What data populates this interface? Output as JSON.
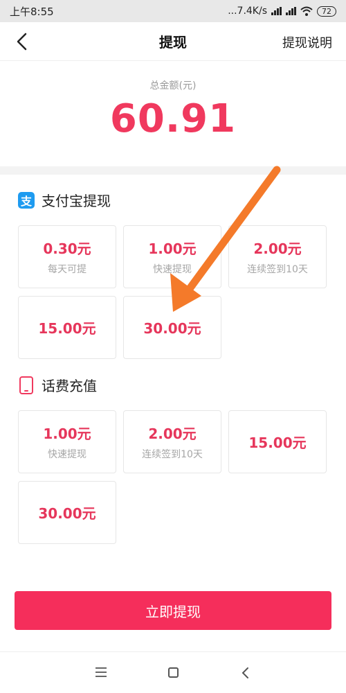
{
  "status": {
    "time": "上午8:55",
    "network_speed": "...7.4K/s",
    "battery": "72"
  },
  "nav": {
    "title": "提现",
    "help_label": "提现说明"
  },
  "total": {
    "label": "总金额(元)",
    "amount": "60.91"
  },
  "alipay": {
    "title": "支付宝提现",
    "icon_glyph": "支",
    "options": [
      {
        "amount": "0.30元",
        "desc": "每天可提"
      },
      {
        "amount": "1.00元",
        "desc": "快速提现"
      },
      {
        "amount": "2.00元",
        "desc": "连续签到10天"
      },
      {
        "amount": "15.00元",
        "desc": ""
      },
      {
        "amount": "30.00元",
        "desc": ""
      }
    ]
  },
  "phone": {
    "title": "话费充值",
    "options": [
      {
        "amount": "1.00元",
        "desc": "快速提现"
      },
      {
        "amount": "2.00元",
        "desc": "连续签到10天"
      },
      {
        "amount": "15.00元",
        "desc": ""
      },
      {
        "amount": "30.00元",
        "desc": ""
      }
    ]
  },
  "withdraw_button": "立即提现",
  "colors": {
    "accent": "#f0395e",
    "button": "#f52e5b",
    "alipay_blue": "#1e9bf0",
    "annotation_arrow": "#f47a2a"
  },
  "icons": {
    "back": "chevron-left-icon",
    "alipay": "alipay-icon",
    "phone": "phone-icon",
    "menu": "menu-icon",
    "home": "home-square-icon",
    "system_back": "chevron-left-icon"
  }
}
